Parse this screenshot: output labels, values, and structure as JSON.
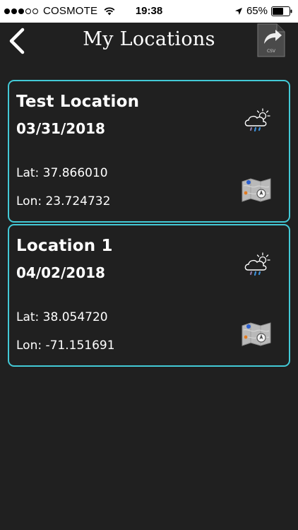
{
  "status_bar": {
    "carrier": "COSMOTE",
    "time": "19:38",
    "battery": "65%",
    "battery_level": 0.65,
    "signal_bars_filled": 3,
    "signal_bars_total": 5
  },
  "nav": {
    "title": "My Locations",
    "back_icon": "chevron-left-icon",
    "export_icon": "csv-export-icon",
    "export_label": "CSV"
  },
  "locations": [
    {
      "name": "Test Location",
      "date": "03/31/2018",
      "lat": "Lat: 37.866010",
      "lon": "Lon: 23.724732",
      "weather_icon": "partly-cloudy-rain-icon",
      "map_icon": "map-icon"
    },
    {
      "name": "Location 1",
      "date": "04/02/2018",
      "lat": "Lat: 38.054720",
      "lon": "Lon: -71.151691",
      "weather_icon": "partly-cloudy-rain-icon",
      "map_icon": "map-icon"
    }
  ],
  "colors": {
    "background": "#202020",
    "card_border": "#43c9d6",
    "text": "#ffffff",
    "status_bar": "#ffffff"
  }
}
